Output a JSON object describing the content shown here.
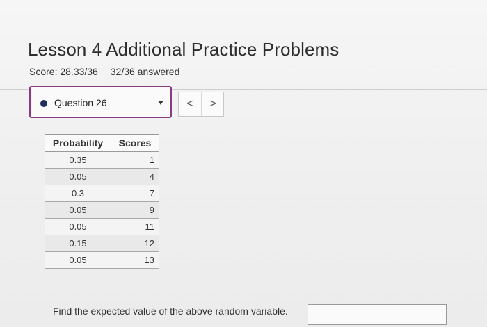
{
  "header": {
    "title": "Lesson 4 Additional Practice Problems",
    "score": "Score: 28.33/36",
    "answered": "32/36 answered"
  },
  "question_select": {
    "value": "Question 26",
    "status_color": "#1f2f5a",
    "border_color": "#8c3a7f"
  },
  "nav": {
    "prev": "<",
    "next": ">"
  },
  "table": {
    "headers": [
      "Probability",
      "Scores"
    ],
    "rows": [
      [
        "0.35",
        "1"
      ],
      [
        "0.05",
        "4"
      ],
      [
        "0.3",
        "7"
      ],
      [
        "0.05",
        "9"
      ],
      [
        "0.05",
        "11"
      ],
      [
        "0.15",
        "12"
      ],
      [
        "0.05",
        "13"
      ]
    ]
  },
  "question": {
    "prompt": "Find the expected value of the above random variable.",
    "answer_value": ""
  }
}
